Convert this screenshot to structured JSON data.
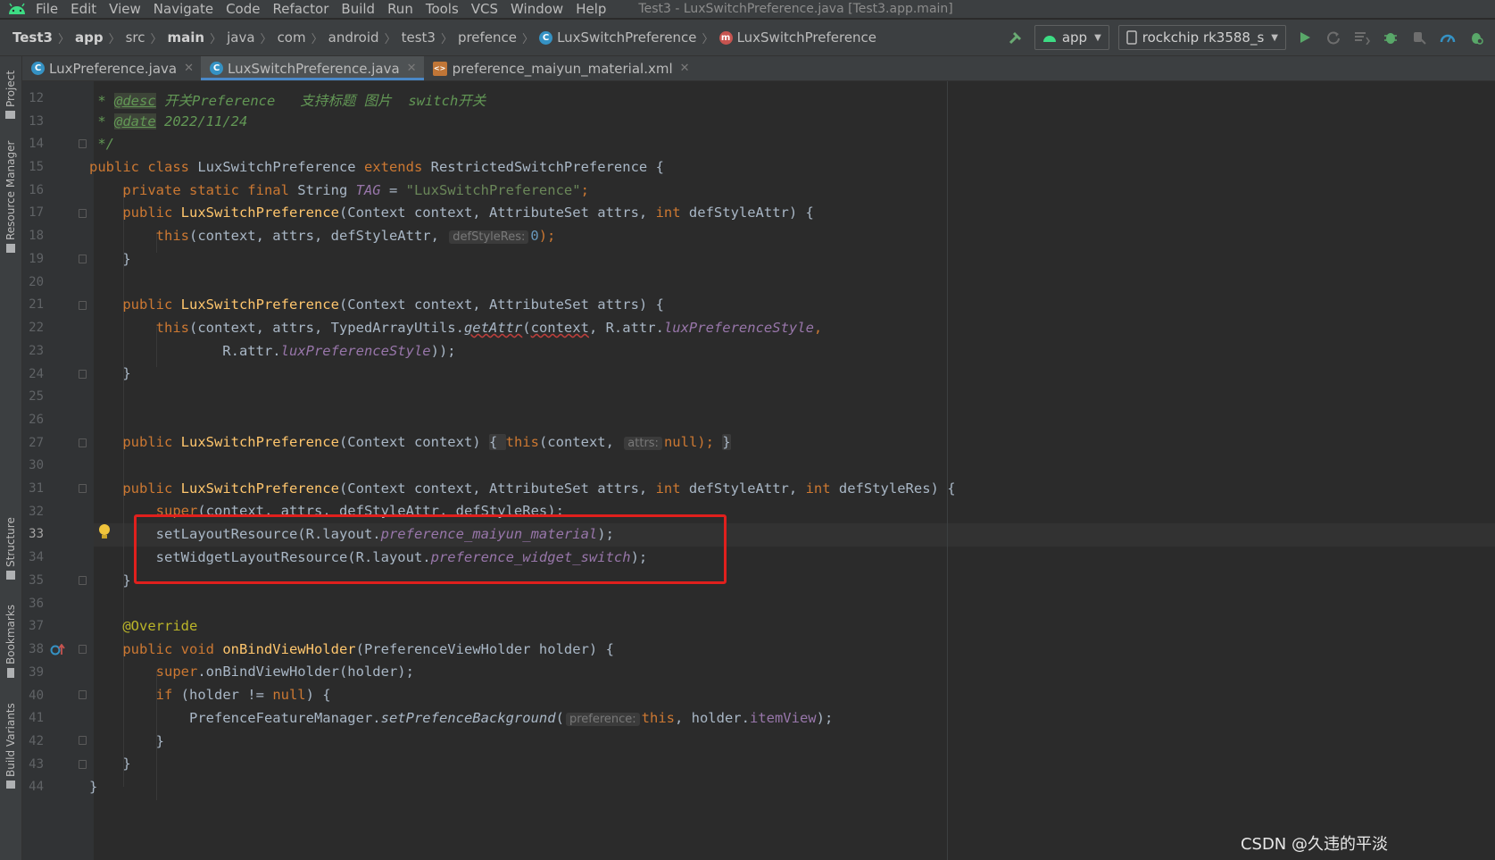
{
  "menu": {
    "items": [
      "File",
      "Edit",
      "View",
      "Navigate",
      "Code",
      "Refactor",
      "Build",
      "Run",
      "Tools",
      "VCS",
      "Window",
      "Help"
    ],
    "window_title": "Test3 - LuxSwitchPreference.java [Test3.app.main]"
  },
  "breadcrumb": {
    "project": "Test3",
    "module": "app",
    "src": "src",
    "main": "main",
    "java": "java",
    "com": "com",
    "android": "android",
    "test3": "test3",
    "prefence": "prefence",
    "class": "LuxSwitchPreference",
    "member": "LuxSwitchPreference"
  },
  "toolbar": {
    "run_config": "app",
    "device": "rockchip rk3588_s"
  },
  "side_tools": {
    "project": "Project",
    "resource_manager": "Resource Manager",
    "structure": "Structure",
    "bookmarks": "Bookmarks",
    "build_variants": "Build Variants"
  },
  "tabs": [
    {
      "label": "LuxPreference.java"
    },
    {
      "label": "LuxSwitchPreference.java"
    },
    {
      "label": "preference_maiyun_material.xml"
    }
  ],
  "line_numbers": [
    "12",
    "13",
    "14",
    "15",
    "16",
    "17",
    "18",
    "19",
    "20",
    "21",
    "22",
    "23",
    "24",
    "25",
    "26",
    "27",
    "30",
    "31",
    "32",
    "33",
    "34",
    "35",
    "36",
    "37",
    "38",
    "39",
    "40",
    "41",
    "42",
    "43",
    "44"
  ],
  "code": {
    "l12_star": " * ",
    "l12_tag": "@desc",
    "l12_text": " 开关Preference   支持标题 图片  switch开关",
    "l13_star": " * ",
    "l13_tag": "@date",
    "l13_text": " 2022/11/24",
    "l14": " */",
    "l15_kw": "public class ",
    "l15_name": "LuxSwitchPreference ",
    "l15_kw2": "extends ",
    "l15_rest": "RestrictedSwitchPreference {",
    "l16_kw": "    private static final ",
    "l16_type": "String ",
    "l16_field": "TAG",
    "l16_eq": " = ",
    "l16_str": "\"LuxSwitchPreference\"",
    "l16_semi": ";",
    "l17_kw": "    public ",
    "l17_fn": "LuxSwitchPreference",
    "l17_args": "(Context context, AttributeSet attrs, ",
    "l17_int": "int ",
    "l17_end": "defStyleAttr) {",
    "l18_kw": "        this",
    "l18_args": "(context, attrs, defStyleAttr, ",
    "l18_hint": "defStyleRes:",
    "l18_val": "0",
    "l18_end": ");",
    "l19": "    }",
    "l21_kw": "    public ",
    "l21_fn": "LuxSwitchPreference",
    "l21_args": "(Context context, AttributeSet attrs) {",
    "l22_kw": "        this",
    "l22_a": "(context, attrs, TypedArrayUtils.",
    "l22_m": "getAttr",
    "l22_b": "(",
    "l22_c": "context",
    "l22_d": ", R.attr.",
    "l22_f": "luxPreferenceStyle",
    "l22_e": ",",
    "l23_a": "                R.attr.",
    "l23_f": "luxPreferenceStyle",
    "l23_e": "));",
    "l24": "    }",
    "l27_kw": "    public ",
    "l27_fn": "LuxSwitchPreference",
    "l27_args": "(Context context) ",
    "l27_ob": "{ ",
    "l27_this": "this",
    "l27_mid": "(context, ",
    "l27_hint": "attrs:",
    "l27_null": "null",
    "l27_end": "); ",
    "l27_cb": "}",
    "l31_kw": "    public ",
    "l31_fn": "LuxSwitchPreference",
    "l31_args": "(Context context, AttributeSet attrs, ",
    "l31_int": "int ",
    "l31_mid": "defStyleAttr, ",
    "l31_int2": "int ",
    "l31_end": "defStyleRes) {",
    "l32_kw": "        super",
    "l32_rest": "(context, attrs, defStyleAttr, defStyleRes);",
    "l33_a": "        setLayoutResource(R.layout.",
    "l33_f": "preference_maiyun_material",
    "l33_e": ");",
    "l34_a": "        setWidgetLayoutResource(R.layout.",
    "l34_f": "preference_widget_switch",
    "l34_e": ");",
    "l35": "    }",
    "l37": "    @Override",
    "l38_kw": "    public void ",
    "l38_fn": "onBindViewHolder",
    "l38_rest": "(PreferenceViewHolder holder) {",
    "l39_kw": "        super",
    "l39_rest": ".onBindViewHolder(holder);",
    "l40_kw": "        if ",
    "l40_a": "(holder != ",
    "l40_null": "null",
    "l40_b": ") {",
    "l41_a": "            PrefenceFeatureManager.",
    "l41_m": "setPrefenceBackground",
    "l41_b": "(",
    "l41_hint": "preference:",
    "l41_this": "this",
    "l41_c": ", holder.",
    "l41_f": "itemView",
    "l41_e": ");",
    "l42": "        }",
    "l43": "    }",
    "l44": "}"
  },
  "watermark": "CSDN @久违的平淡",
  "colors": {
    "editor_bg": "#2b2b2b",
    "keyword": "#cc7832",
    "method_decl": "#ffc66d",
    "string": "#6a8759",
    "field": "#9876aa",
    "highlight_box": "#e0201d"
  }
}
